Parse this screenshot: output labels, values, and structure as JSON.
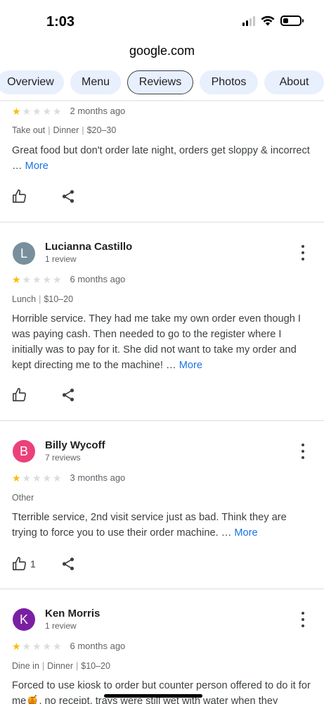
{
  "status_bar": {
    "time": "1:03",
    "battery_percent": 30
  },
  "browser": {
    "url": "google.com"
  },
  "tabs": [
    {
      "label": "Overview",
      "active": false
    },
    {
      "label": "Menu",
      "active": false
    },
    {
      "label": "Reviews",
      "active": true
    },
    {
      "label": "Photos",
      "active": false
    },
    {
      "label": "About",
      "active": false
    }
  ],
  "reviews": [
    {
      "rating": 1,
      "date": "2 months ago",
      "meta": [
        "Take out",
        "Dinner",
        "$20–30"
      ],
      "text": "Great food but don't order late night, orders get sloppy & incorrect …",
      "more_label": "More",
      "likes": ""
    },
    {
      "avatar_initial": "L",
      "avatar_color": "#78909c",
      "name": "Lucianna Castillo",
      "review_count": "1 review",
      "rating": 1,
      "date": "6 months ago",
      "meta": [
        "Lunch",
        "$10–20"
      ],
      "text": "Horrible service. They had me take my own order even though I was paying cash. Then needed to go to the register where I initially was to pay for it. She did not want to take my order and kept directing me to the machine! …",
      "more_label": "More",
      "likes": ""
    },
    {
      "avatar_initial": "B",
      "avatar_color": "#ec407a",
      "name": "Billy Wycoff",
      "review_count": "7 reviews",
      "rating": 1,
      "date": "3 months ago",
      "meta": [
        "Other"
      ],
      "text": "Tterrible service, 2nd visit service just as bad. Think they are trying to force you to use their order machine. …",
      "more_label": "More",
      "likes": "1"
    },
    {
      "avatar_initial": "K",
      "avatar_color": "#7b1fa2",
      "name": "Ken Morris",
      "review_count": "1 review",
      "rating": 1,
      "date": "6 months ago",
      "meta": [
        "Dine in",
        "Dinner",
        "$10–20"
      ],
      "text": "Forced to use kiosk to order but counter person offered to do it for me🍯, no receipt, trays were still wet with water when they",
      "more_label": "",
      "likes": ""
    }
  ]
}
